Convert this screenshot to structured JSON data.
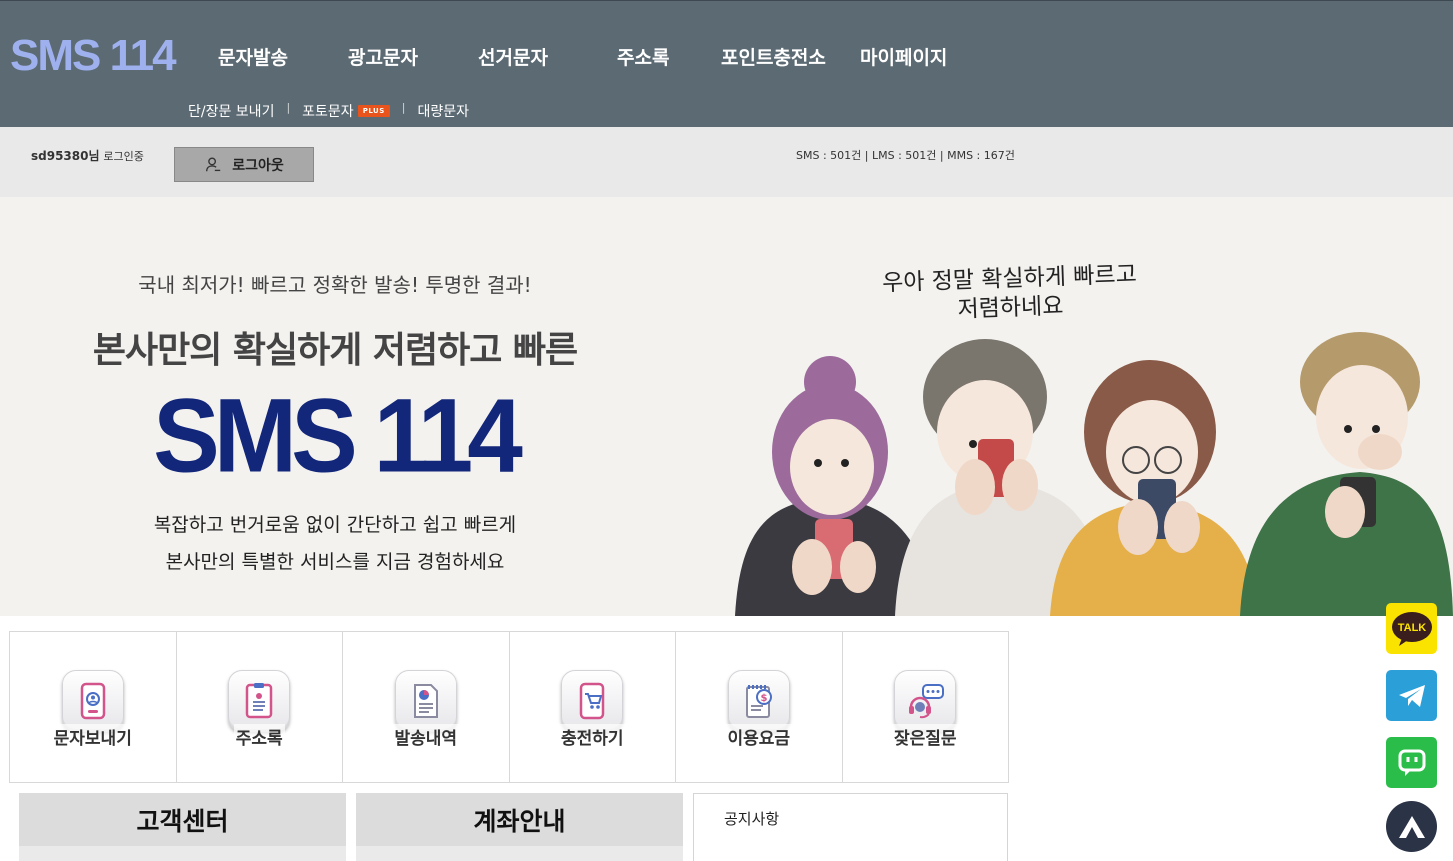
{
  "header": {
    "logo": "SMS 114",
    "nav": [
      "문자발송",
      "광고문자",
      "선거문자",
      "주소록",
      "포인트충전소",
      "마이페이지"
    ],
    "subnav": [
      {
        "label": "단/장문 보내기"
      },
      {
        "label": "포토문자",
        "badge": "PLUS"
      },
      {
        "label": "대량문자"
      }
    ]
  },
  "userbar": {
    "user_id": "sd95380님",
    "status": "로그인중",
    "logout_label": "로그아웃",
    "balance": "SMS : 501건 | LMS : 501건 | MMS : 167건"
  },
  "hero": {
    "subtitle": "국내 최저가! 빠르고 정확한 발송! 투명한 결과!",
    "title": "본사만의 확실하게 저렴하고 빠른",
    "brand": "SMS 114",
    "desc_line1": "복잡하고 번거로움 없이 간단하고 쉽고 빠르게",
    "desc_line2": "본사만의 특별한 서비스를 지금 경험하세요",
    "speech_line1": "우아 정말 확실하게 빠르고",
    "speech_line2": "저렴하네요"
  },
  "quick_menu": [
    {
      "label": "문자보내기",
      "icon": "phone-message-icon"
    },
    {
      "label": "주소록",
      "icon": "address-book-icon"
    },
    {
      "label": "발송내역",
      "icon": "document-chart-icon"
    },
    {
      "label": "충전하기",
      "icon": "phone-cart-icon"
    },
    {
      "label": "이용요금",
      "icon": "price-note-icon"
    },
    {
      "label": "잦은질문",
      "icon": "support-headset-icon"
    }
  ],
  "panels": {
    "customer_center": "고객센터",
    "account_info": "계좌안내",
    "notice": "공지사항"
  },
  "floating": {
    "talk_label": "TALK"
  },
  "colors": {
    "header_bg": "#5b6a73",
    "logo": "#9fb0ee",
    "brand_navy": "#13277a",
    "plus_badge": "#e8541b",
    "kakao_yellow": "#fbe300",
    "telegram_blue": "#2a9fd8",
    "chat_green": "#2bbd4a",
    "top_button": "#2b3346"
  }
}
